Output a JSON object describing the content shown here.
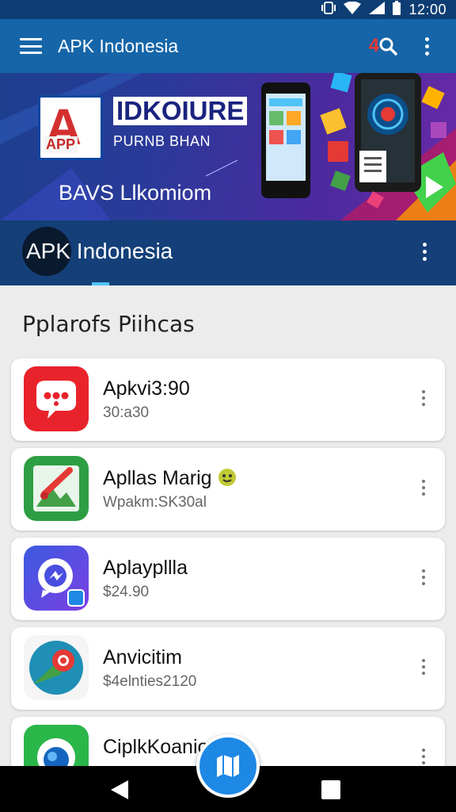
{
  "status_bar": {
    "time": "12:00"
  },
  "app_bar": {
    "title": "APK Indonesia",
    "badge": "4"
  },
  "banner": {
    "logo_letter": "A",
    "logo_text": "APP",
    "title": "IDKOIURE",
    "subtitle": "PURNB BHAN",
    "tagline": "BAVS Llkomiom"
  },
  "channel": {
    "name": "APK Indonesia"
  },
  "section": {
    "title": "Pplarofs Piihcas"
  },
  "apps": [
    {
      "name": "Apkvi3:90",
      "meta": "30:a30",
      "icon": "chat-bubble-icon",
      "color": "#e8232b"
    },
    {
      "name": "Apllas Marig",
      "meta": "Wpakm:SK30al",
      "icon": "photo-brush-icon",
      "color": "#2e9e43"
    },
    {
      "name": "Aplaypllla",
      "meta": "$24.90",
      "icon": "messenger-icon",
      "color": "#4a4ee0"
    },
    {
      "name": "Anvicitim",
      "meta": "$4elnties2120",
      "icon": "map-pin-icon",
      "color": "#1f8fb5"
    },
    {
      "name": "CiplkKoanio",
      "meta": "",
      "icon": "globe-icon",
      "color": "#2bb64a"
    }
  ],
  "colors": {
    "app_bar": "#1565a8",
    "channel_bar": "#143f78",
    "fab": "#1e88e5"
  }
}
